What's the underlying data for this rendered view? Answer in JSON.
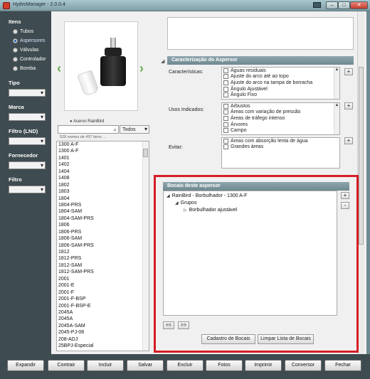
{
  "window": {
    "title": "HydroManager - 2.0.0.4",
    "controls": {
      "minimize": "–",
      "maximize": "□",
      "close": "✕"
    }
  },
  "sidebar": {
    "itens_heading": "Itens",
    "items": [
      {
        "label": "Tubos",
        "selected": false
      },
      {
        "label": "Aspersores",
        "selected": true
      },
      {
        "label": "Válvulas",
        "selected": false
      },
      {
        "label": "Controlador",
        "selected": false
      },
      {
        "label": "Bomba",
        "selected": false
      }
    ],
    "filters": [
      {
        "heading": "Tipo"
      },
      {
        "heading": "Marca"
      },
      {
        "heading": "Filtro (LND)"
      },
      {
        "heading": "Fornecedor"
      },
      {
        "heading": "Filtro"
      }
    ]
  },
  "product": {
    "caption": "Acervo RainBird",
    "search_placeholder": "",
    "filter_value": "Todos",
    "count_text": "528 nomes de 457 itens ...",
    "list": [
      "1300 A-F",
      "1300 A-F",
      "1401",
      "1402",
      "1404",
      "1408",
      "1802",
      "1803",
      "1804",
      "1804-PRS",
      "1804-SAM",
      "1804-SAM-PRS",
      "1806",
      "1806-PRS",
      "1806-SAM",
      "1806-SAM-PRS",
      "1812",
      "1812-PRS",
      "1812-SAM",
      "1812-SAM-PRS",
      "2001",
      "2001-E",
      "2001-F",
      "2001-F-BSP",
      "2001-F-BSP-E",
      "2045A",
      "2045A",
      "2045A-SAM",
      "2045-PJ-08",
      "208-ADJ",
      "25BPJ-Especial"
    ]
  },
  "caracterizacao": {
    "header": "Caracterização do Aspersor",
    "caracteristicas_label": "Características:",
    "caracteristicas": [
      "Águas residuais",
      "Ajuste do arco até ao topo",
      "Ajuste do arco na tampa de borracha",
      "Ângulo Ajustável",
      "Ângulo Fixo"
    ],
    "usos_label": "Usos Indicados:",
    "usos": [
      "Arbustos",
      "Áreas com variação de pressão",
      "Áreas de tráfego intenso",
      "Árvores",
      "Campo"
    ],
    "evitar_label": "Evitar:",
    "evitar": [
      "Áreas com absorção lenta de água",
      "Grandes áreas"
    ],
    "add_symbol": "+",
    "remove_symbol": "-"
  },
  "bocais": {
    "header": "Bocais deste aspersor",
    "tree": {
      "root": "RainBird - Borbulhador - 1300 A-F",
      "group": "Grupos",
      "leaf": "Borbulhador ajustável"
    },
    "prev_label": "<<",
    "next_label": ">>",
    "cadastro_label": "Cadastro de Bocais",
    "limpar_label": "Limpar Lista de Bocais"
  },
  "toolbar": {
    "buttons": [
      "Expandir",
      "Contrair",
      "Incluir",
      "Salvar",
      "Excluir",
      "Fotos",
      "Imprimir",
      "Conversor",
      "Fechar"
    ]
  },
  "colors": {
    "sidebar_bg": "#3e4b50",
    "highlight_frame": "#d61d24",
    "section_header": "#7f979e"
  }
}
